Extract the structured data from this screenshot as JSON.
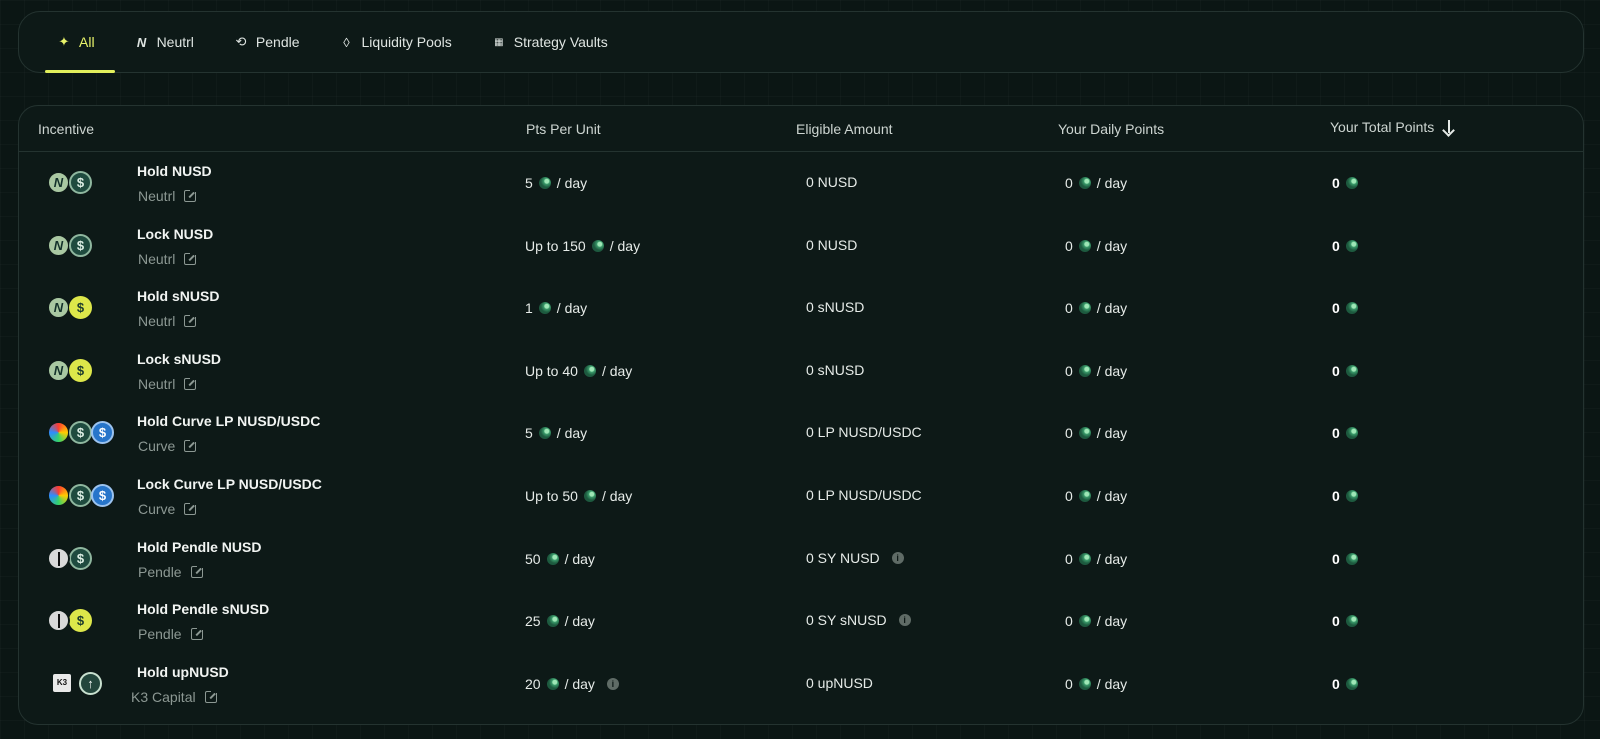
{
  "tabs": [
    {
      "label": "All",
      "icon": "sparkle-icon",
      "active": true
    },
    {
      "label": "Neutrl",
      "icon": "neutrl-logo-icon",
      "active": false
    },
    {
      "label": "Pendle",
      "icon": "pendle-logo-icon",
      "active": false
    },
    {
      "label": "Liquidity Pools",
      "icon": "droplet-icon",
      "active": false
    },
    {
      "label": "Strategy Vaults",
      "icon": "vault-grid-icon",
      "active": false
    }
  ],
  "table": {
    "headers": {
      "incentive": "Incentive",
      "pts_per_unit": "Pts Per Unit",
      "eligible_amount": "Eligible Amount",
      "daily_points": "Your Daily Points",
      "total_points": "Your Total Points"
    },
    "per_day": "/ day",
    "rows": [
      {
        "name": "Hold NUSD",
        "source": "Neutrl",
        "pts_prefix": "5",
        "eligible": "0 NUSD",
        "daily": "0",
        "total": "0"
      },
      {
        "name": "Lock NUSD",
        "source": "Neutrl",
        "pts_prefix": "Up to 150",
        "eligible": "0 NUSD",
        "daily": "0",
        "total": "0"
      },
      {
        "name": "Hold sNUSD",
        "source": "Neutrl",
        "pts_prefix": "1",
        "eligible": "0 sNUSD",
        "daily": "0",
        "total": "0"
      },
      {
        "name": "Lock sNUSD",
        "source": "Neutrl",
        "pts_prefix": "Up to 40",
        "eligible": "0 sNUSD",
        "daily": "0",
        "total": "0"
      },
      {
        "name": "Hold Curve LP NUSD/USDC",
        "source": "Curve",
        "pts_prefix": "5",
        "eligible": "0 LP NUSD/USDC",
        "daily": "0",
        "total": "0"
      },
      {
        "name": "Lock Curve LP NUSD/USDC",
        "source": "Curve",
        "pts_prefix": "Up to 50",
        "eligible": "0 LP NUSD/USDC",
        "daily": "0",
        "total": "0"
      },
      {
        "name": "Hold Pendle NUSD",
        "source": "Pendle",
        "pts_prefix": "50",
        "eligible": "0 SY NUSD",
        "daily": "0",
        "total": "0"
      },
      {
        "name": "Hold Pendle sNUSD",
        "source": "Pendle",
        "pts_prefix": "25",
        "eligible": "0 SY sNUSD",
        "daily": "0",
        "total": "0"
      },
      {
        "name": "Hold upNUSD",
        "source": "K3 Capital",
        "pts_prefix": "20",
        "eligible": "0 upNUSD",
        "daily": "0",
        "total": "0"
      }
    ]
  },
  "colors": {
    "background": "#0b1614",
    "accent": "#e2ef5c",
    "border": "#243330"
  }
}
